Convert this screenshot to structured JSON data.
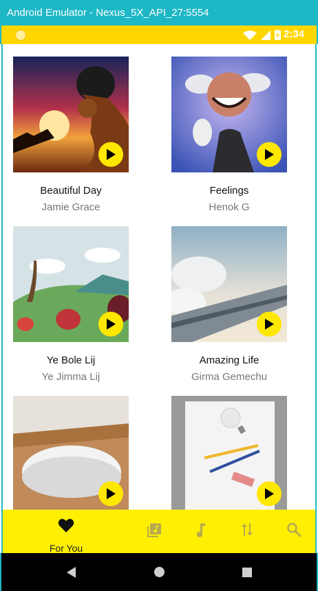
{
  "window": {
    "title": "Android Emulator - Nexus_5X_API_27:5554"
  },
  "status_bar": {
    "time": "2:34"
  },
  "songs": [
    {
      "title": "Beautiful Day",
      "artist": "Jamie Grace"
    },
    {
      "title": "Feelings",
      "artist": "Henok G"
    },
    {
      "title": "Ye Bole Lij",
      "artist": "Ye Jimma Lij"
    },
    {
      "title": "Amazing Life",
      "artist": "Girma Gemechu"
    },
    {
      "title": "",
      "artist": ""
    },
    {
      "title": "",
      "artist": ""
    }
  ],
  "bottom_nav": {
    "items": [
      {
        "icon": "heart-icon",
        "label": "For You",
        "active": true
      },
      {
        "icon": "library-icon",
        "label": ""
      },
      {
        "icon": "music-note-icon",
        "label": ""
      },
      {
        "icon": "sort-icon",
        "label": ""
      },
      {
        "icon": "search-icon",
        "label": ""
      }
    ]
  },
  "colors": {
    "accent": "#FFE800",
    "status_bar": "#FFD600",
    "window_title_bg": "#1EB7C6"
  }
}
